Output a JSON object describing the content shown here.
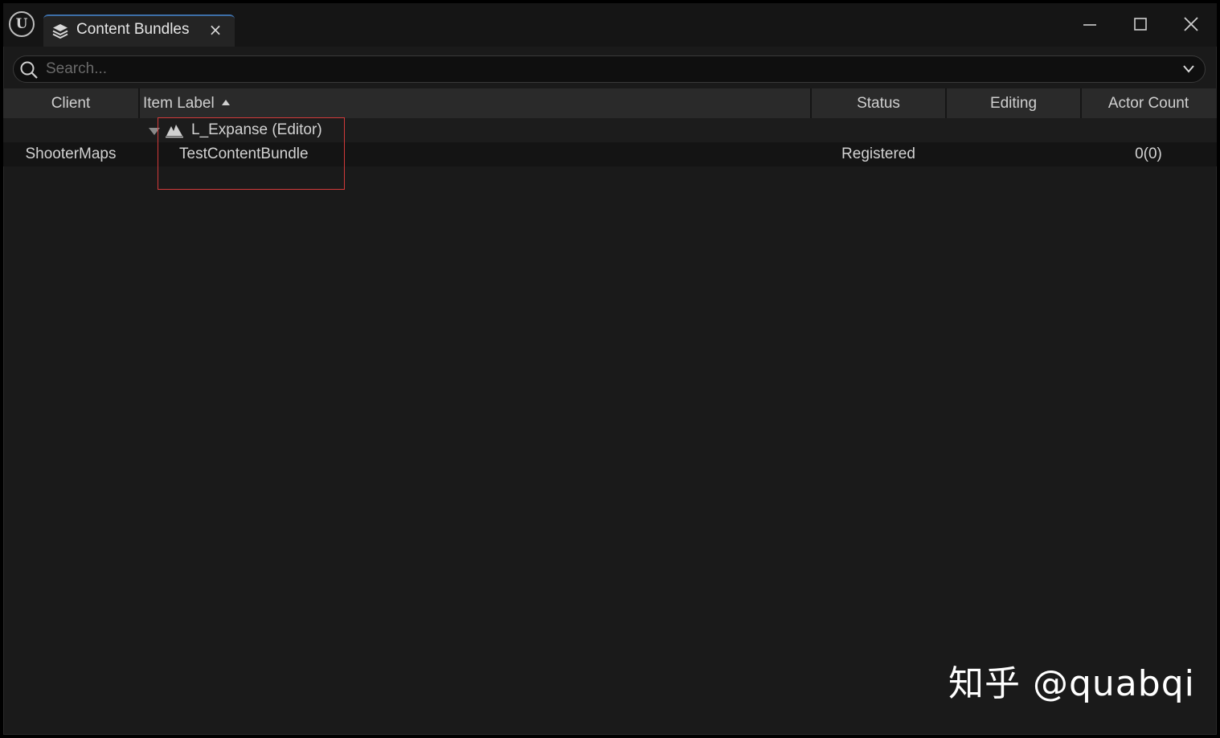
{
  "window": {
    "tab_title": "Content Bundles",
    "tab_close_glyph": "×",
    "app_logo_glyph": "U",
    "icons": {
      "app": "unreal-logo-icon",
      "tab": "content-bundles-stack-icon",
      "minimize": "minimize-icon",
      "maximize": "maximize-icon",
      "close": "close-icon"
    }
  },
  "search": {
    "placeholder": "Search...",
    "value": ""
  },
  "columns": {
    "client": "Client",
    "item_label": "Item Label",
    "status": "Status",
    "editing": "Editing",
    "actor_count": "Actor Count",
    "sort_column": "item_label",
    "sort_direction": "ascending"
  },
  "rows": [
    {
      "client": "",
      "item_label": "L_Expanse (Editor)",
      "status": "",
      "editing": "",
      "actor_count": "",
      "expanded": true,
      "icon": "level-icon"
    },
    {
      "client": "ShooterMaps",
      "item_label": "TestContentBundle",
      "status": "Registered",
      "editing": "",
      "actor_count": "0(0)"
    }
  ],
  "watermark": "知乎 @quabqi",
  "colors": {
    "background": "#1a1a1a",
    "header": "#2a2a2a",
    "tab_accent": "#3d6fa8",
    "highlight_box": "#d23a3a"
  }
}
